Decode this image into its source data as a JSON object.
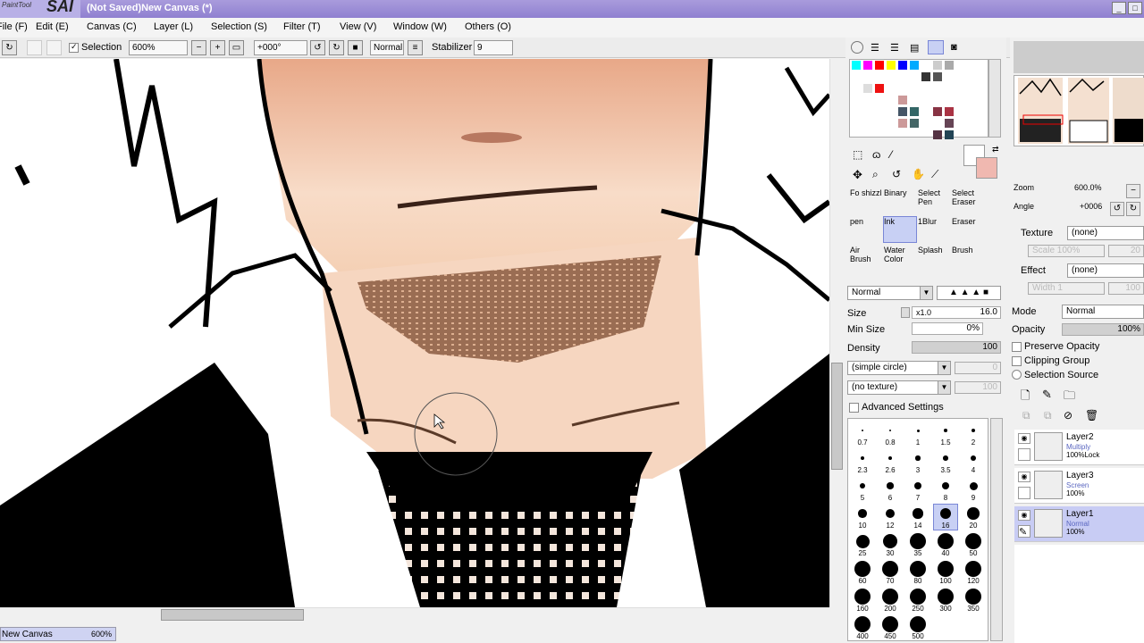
{
  "app": {
    "logo_small": "PaintTool",
    "logo_big": "SAI",
    "title": "(Not Saved)New Canvas (*)"
  },
  "menu": [
    "File (F)",
    "Edit (E)",
    "Canvas (C)",
    "Layer (L)",
    "Selection (S)",
    "Filter (T)",
    "View (V)",
    "Window (W)",
    "Others (O)"
  ],
  "toolbar": {
    "selection_label": "Selection",
    "zoom": "600%",
    "angle": "+000°",
    "mode": "Normal",
    "stabilizer_label": "Stabilizer",
    "stabilizer": "9"
  },
  "navigator": {
    "zoom_label": "Zoom",
    "zoom": "600.0%",
    "angle_label": "Angle",
    "angle": "+0006"
  },
  "texture": {
    "label": "Texture",
    "value": "(none)",
    "scale_label": "Scale",
    "scale": "100%",
    "scale2": "20"
  },
  "effect": {
    "label": "Effect",
    "value": "(none)",
    "width_label": "Width",
    "width": "1",
    "width2": "100"
  },
  "layer_mode": {
    "label": "Mode",
    "value": "Normal"
  },
  "layer_opacity": {
    "label": "Opacity",
    "value": "100%"
  },
  "layer_options": [
    "Preserve Opacity",
    "Clipping Group",
    "Selection Source"
  ],
  "layers": [
    {
      "name": "Layer2",
      "mode": "Multiply",
      "opacity": "100%",
      "extra": "Lock"
    },
    {
      "name": "Layer3",
      "mode": "Screen",
      "opacity": "100%",
      "extra": ""
    },
    {
      "name": "Layer1",
      "mode": "Normal",
      "opacity": "100%",
      "extra": ""
    }
  ],
  "tools": [
    {
      "label": "Fo shizzl"
    },
    {
      "label": "Binary"
    },
    {
      "label": "Select Pen"
    },
    {
      "label": "Select Eraser"
    },
    {
      "label": "pen"
    },
    {
      "label": "Ink"
    },
    {
      "label": "1Blur"
    },
    {
      "label": "Eraser"
    },
    {
      "label": "Air Brush"
    },
    {
      "label": "Water Color"
    },
    {
      "label": "Splash"
    },
    {
      "label": "Brush"
    }
  ],
  "brush": {
    "mode": "Normal",
    "size_label": "Size",
    "size_mult": "x1.0",
    "size": "16.0",
    "minsize_label": "Min Size",
    "minsize": "0%",
    "density_label": "Density",
    "density": "100",
    "shape": "(simple circle)",
    "shape_val": "0",
    "texture": "(no texture)",
    "texture_val": "100",
    "advanced": "Advanced Settings"
  },
  "brush_sizes": [
    "0.7",
    "0.8",
    "1",
    "1.5",
    "2",
    "2.3",
    "2.6",
    "3",
    "3.5",
    "4",
    "5",
    "6",
    "7",
    "8",
    "9",
    "10",
    "12",
    "14",
    "16",
    "20",
    "25",
    "30",
    "35",
    "40",
    "50",
    "60",
    "70",
    "80",
    "100",
    "120",
    "160",
    "200",
    "250",
    "300",
    "350",
    "400",
    "450",
    "500"
  ],
  "status": {
    "canvas_name": "New Canvas",
    "zoom": "600%"
  },
  "colors": {
    "accent": "#7986d6",
    "title": "#9a8cd6",
    "skin": "#f2c8a8",
    "ink": "#000000"
  },
  "palette": [
    "#00ffff",
    "#ff0000",
    "#ffff00",
    "#0000ff",
    "#00aaff",
    "#cccccc",
    "#888888",
    "#dddddd",
    "#aaaaaa",
    "#e8e8e8",
    "#ff0000",
    "#ff4444",
    "#3366cc",
    "#e8e8e8",
    "#f0c0c0",
    "#cc4444",
    "#445566",
    "#336666",
    "#883344",
    "#aa3344",
    "#cc9999",
    "#664455",
    "#224455",
    "#553344",
    "#bbbbbb"
  ]
}
